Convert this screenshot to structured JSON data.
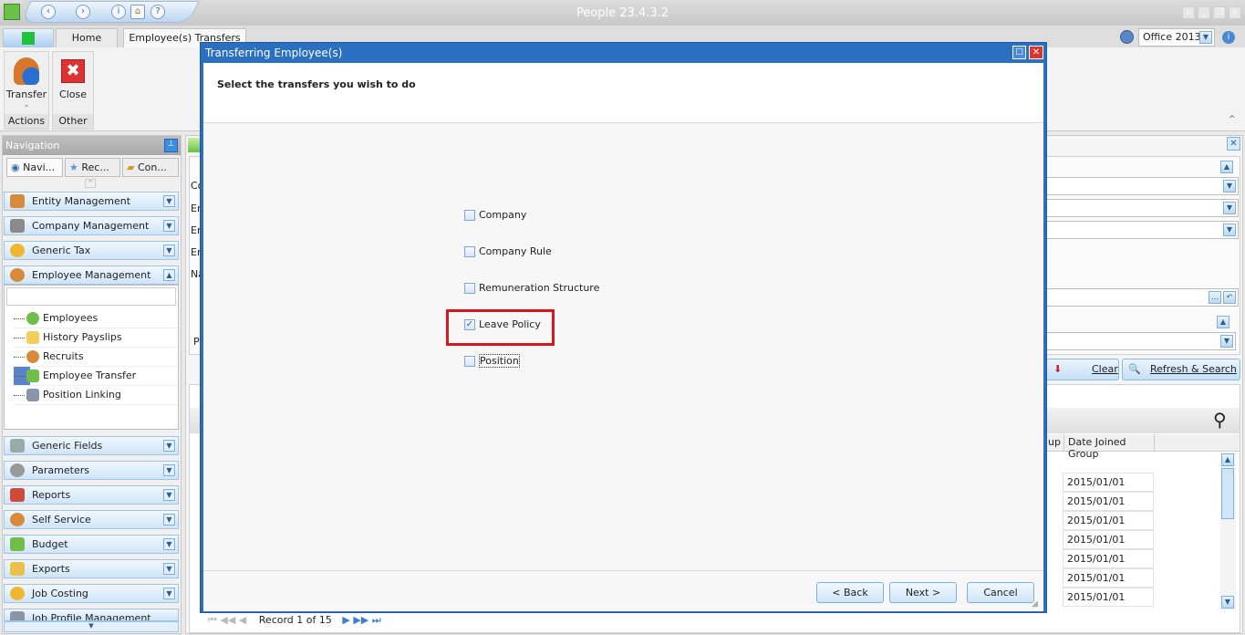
{
  "app": {
    "title": "People 23.4.3.2",
    "theme": "Office 2013"
  },
  "tabs": [
    {
      "label": "Home"
    },
    {
      "label": "Employee(s) Transfers"
    }
  ],
  "ribbon": {
    "transfer": "Transfer",
    "close": "Close",
    "actions": "Actions",
    "other": "Other"
  },
  "nav": {
    "title": "Navigation",
    "tabs": [
      "Navi...",
      "Rec...",
      "Con..."
    ],
    "groups_top": [
      "Entity Management",
      "Company Management",
      "Generic Tax",
      "Employee Management"
    ],
    "subitems": [
      "Employees",
      "History Payslips",
      "Recruits",
      "Employee Transfer",
      "Position Linking"
    ],
    "selected_subitem": "Employee Transfer",
    "groups_bottom": [
      "Generic Fields",
      "Parameters",
      "Reports",
      "Self Service",
      "Budget",
      "Exports",
      "Job Costing",
      "Job Profile Management"
    ]
  },
  "main": {
    "clear": "Clear",
    "refresh": "Refresh & Search",
    "col_partial": "up",
    "col_date": "Date Joined Group",
    "dates": [
      "2015/01/01",
      "2015/01/01",
      "2015/01/01",
      "2015/01/01",
      "2015/01/01",
      "2015/01/01",
      "2015/01/01"
    ],
    "record": "Record 1 of 15",
    "left_letters": [
      "Co",
      "En",
      "En",
      "En",
      "Na",
      "P"
    ]
  },
  "dialog": {
    "title": "Transferring Employee(s)",
    "heading": "Select the transfers you wish to do",
    "options": [
      {
        "label": "Company",
        "checked": false
      },
      {
        "label": "Company Rule",
        "checked": false
      },
      {
        "label": "Remuneration Structure",
        "checked": false
      },
      {
        "label": "Leave Policy",
        "checked": true
      },
      {
        "label": "Position",
        "checked": false
      }
    ],
    "back": "< Back",
    "next": "Next >",
    "cancel": "Cancel",
    "highlight_color": "#d9161e"
  }
}
